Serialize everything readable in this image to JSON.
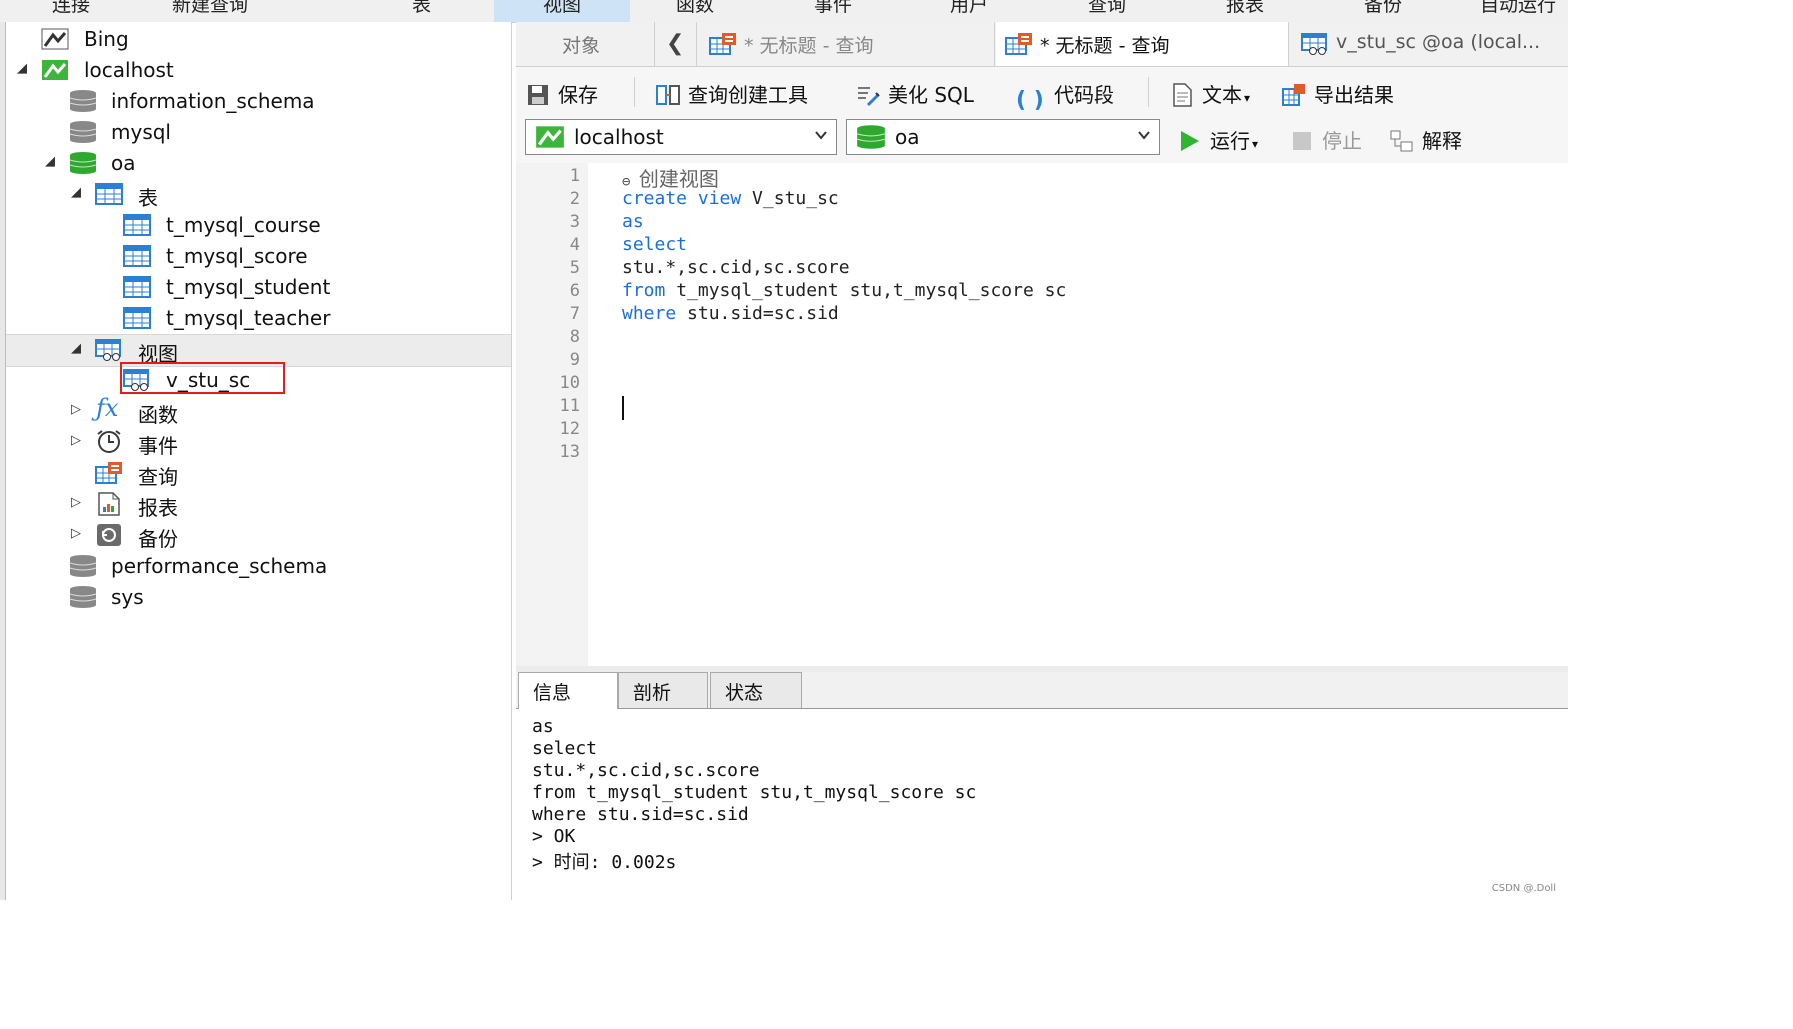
{
  "menu": [
    "连接",
    "新建查询",
    "表",
    "视图",
    "函数",
    "事件",
    "用户",
    "查询",
    "报表",
    "备份",
    "自动运行"
  ],
  "tree": {
    "bing": "Bing",
    "localhost": "localhost",
    "information_schema": "information_schema",
    "mysql": "mysql",
    "oa": "oa",
    "tables_group": "表",
    "tables": [
      "t_mysql_course",
      "t_mysql_score",
      "t_mysql_student",
      "t_mysql_teacher"
    ],
    "views_group": "视图",
    "views": [
      "v_stu_sc"
    ],
    "functions": "函数",
    "events": "事件",
    "queries": "查询",
    "reports": "报表",
    "backups": "备份",
    "performance_schema": "performance_schema",
    "sys": "sys"
  },
  "tabs": {
    "objects": "对象",
    "query1": "* 无标题 - 查询",
    "query2": "* 无标题 - 查询",
    "view_tab": "v_stu_sc @oa (local..."
  },
  "toolbar": {
    "save": "保存",
    "query_builder": "查询创建工具",
    "beautify": "美化 SQL",
    "snippet": "代码段",
    "text": "文本",
    "export": "导出结果",
    "run": "运行",
    "stop": "停止",
    "explain": "解释"
  },
  "connection": {
    "server": "localhost",
    "database": "oa"
  },
  "editor": {
    "line_numbers": [
      "1",
      "2",
      "3",
      "4",
      "5",
      "6",
      "7",
      "8",
      "9",
      "10",
      "11",
      "12",
      "13"
    ],
    "comment": "创建视图",
    "l2_kw": "create view",
    "l2_rest": " V_stu_sc",
    "l3_kw": "as",
    "l4_kw": "select",
    "l5": "stu.*,sc.cid,sc.score",
    "l6_kw": "from",
    "l6_rest": " t_mysql_student stu,t_mysql_score sc",
    "l7_kw": "where",
    "l7_rest": " stu.sid=sc.sid"
  },
  "bottom_tabs": [
    "信息",
    "剖析",
    "状态"
  ],
  "output": [
    "as",
    "select",
    "stu.*,sc.cid,sc.score",
    "from t_mysql_student stu,t_mysql_score sc",
    "where stu.sid=sc.sid",
    "> OK",
    "> 时间: 0.002s"
  ],
  "watermark": "CSDN @.Doll"
}
